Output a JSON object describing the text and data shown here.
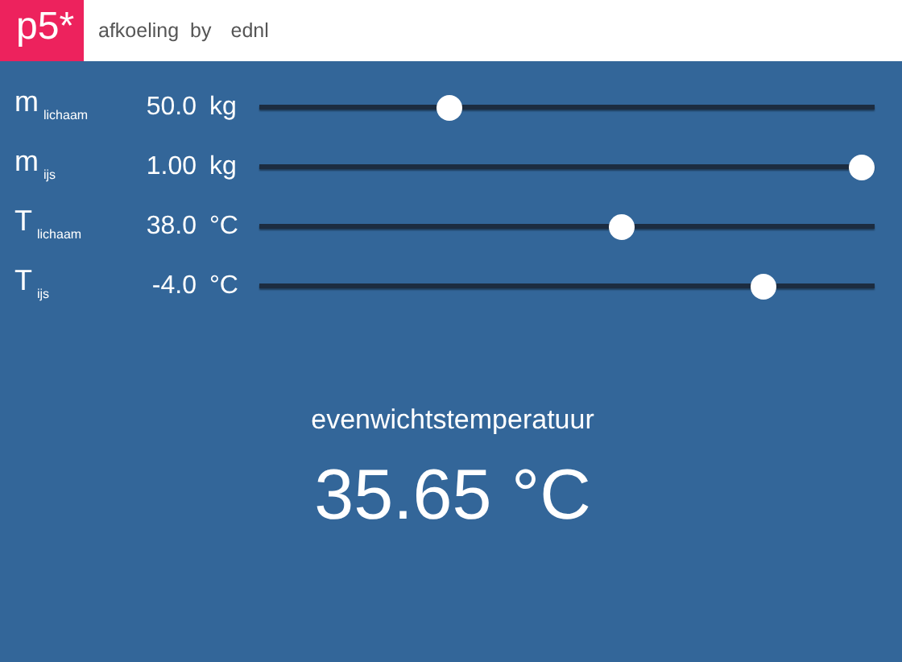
{
  "header": {
    "logo": "p5*",
    "sketch_title": "afkoeling",
    "by": "by",
    "author": "ednl"
  },
  "sliders": [
    {
      "symbol": "m",
      "subscript": "lichaam",
      "value": "50.0",
      "unit": "kg",
      "level": 0.31
    },
    {
      "symbol": "m",
      "subscript": "ijs",
      "value": "1.00",
      "unit": "kg",
      "level": 0.98
    },
    {
      "symbol": "T",
      "subscript": "lichaam",
      "value": "38.0",
      "unit": "°C",
      "level": 0.59
    },
    {
      "symbol": "T",
      "subscript": "ijs",
      "value": "-4.0",
      "unit": "°C",
      "level": 0.82
    }
  ],
  "result": {
    "label": "evenwichtstemperatuur",
    "value": "35.65 °C"
  }
}
